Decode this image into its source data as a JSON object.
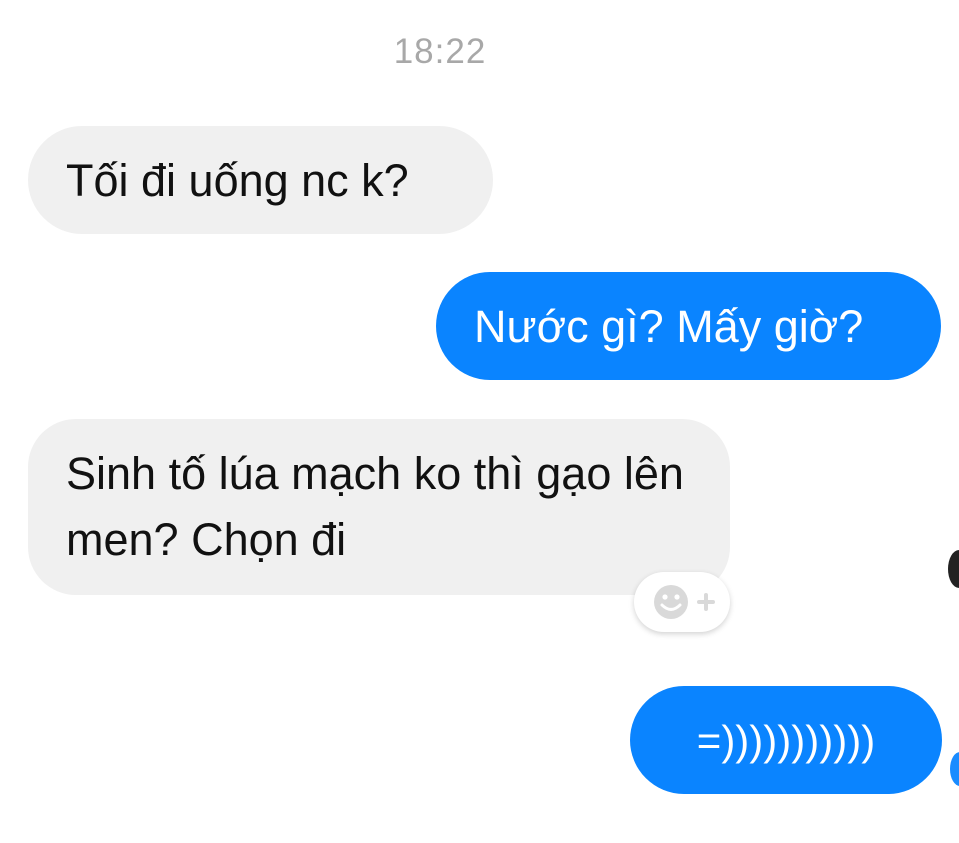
{
  "chat": {
    "timestamp": "18:22",
    "messages": [
      {
        "sender": "other",
        "text": "Tối đi uống nc k?"
      },
      {
        "sender": "me",
        "text": "Nước gì? Mấy giờ?"
      },
      {
        "sender": "other",
        "text": "Sinh tố lúa mạch ko thì gạo lên men? Chọn đi"
      },
      {
        "sender": "me",
        "text": "=)))))))))))"
      }
    ],
    "reaction_icon": "add-reaction-smiley-icon"
  },
  "colors": {
    "incoming_bg": "#f0f0f0",
    "outgoing_bg": "#0a84ff",
    "timestamp_text": "#a8a8a8"
  }
}
